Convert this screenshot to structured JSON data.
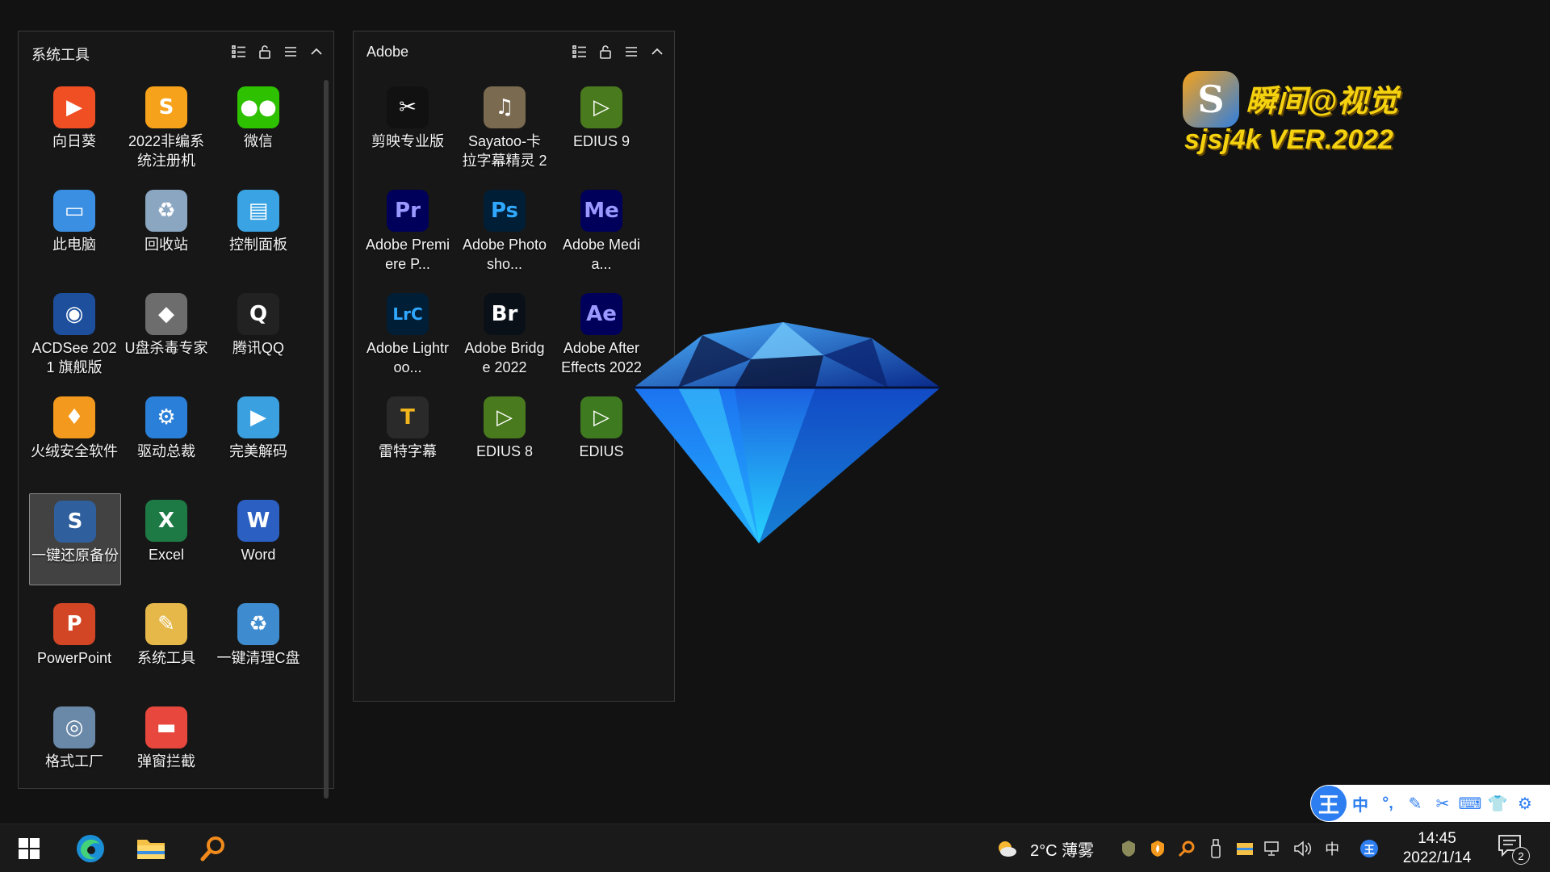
{
  "fences": {
    "system": {
      "title": "系统工具",
      "icons": [
        {
          "label": "向日葵",
          "glyph": "▶",
          "color": "#f04e23",
          "icon": "sunlogin-icon"
        },
        {
          "label": "2022非编系统注册机",
          "glyph": "S",
          "color": "#f7a21b",
          "icon": "registration-tool-icon"
        },
        {
          "label": "微信",
          "glyph": "●●",
          "color": "#2dc100",
          "icon": "wechat-icon"
        },
        {
          "label": "此电脑",
          "glyph": "▭",
          "color": "#3b8fe3",
          "icon": "this-pc-icon"
        },
        {
          "label": "回收站",
          "glyph": "♻",
          "color": "#8aa6c1",
          "icon": "recycle-bin-icon"
        },
        {
          "label": "控制面板",
          "glyph": "▤",
          "color": "#3aa3e3",
          "icon": "control-panel-icon"
        },
        {
          "label": "ACDSee 2021 旗舰版",
          "glyph": "◉",
          "color": "#1d4f9c",
          "icon": "acdsee-icon"
        },
        {
          "label": "U盘杀毒专家",
          "glyph": "◆",
          "color": "#6d6d6d",
          "icon": "usb-antivirus-icon"
        },
        {
          "label": "腾讯QQ",
          "glyph": "Q",
          "color": "#222222",
          "icon": "qq-icon"
        },
        {
          "label": "火绒安全软件",
          "glyph": "♦",
          "color": "#f39a1e",
          "icon": "huorong-icon"
        },
        {
          "label": "驱动总裁",
          "glyph": "⚙",
          "color": "#2a7fd8",
          "icon": "driver-tool-icon"
        },
        {
          "label": "完美解码",
          "glyph": "▶",
          "color": "#3aa0e0",
          "icon": "potplayer-icon"
        },
        {
          "label": "一键还原备份",
          "glyph": "S",
          "color": "#2f5f9c",
          "icon": "restore-backup-icon"
        },
        {
          "label": "Excel",
          "glyph": "X",
          "color": "#1d7a45",
          "icon": "excel-icon"
        },
        {
          "label": "Word",
          "glyph": "W",
          "color": "#2b5fc2",
          "icon": "word-icon"
        },
        {
          "label": "PowerPoint",
          "glyph": "P",
          "color": "#d24625",
          "icon": "powerpoint-icon"
        },
        {
          "label": "系统工具",
          "glyph": "✎",
          "color": "#e6b84a",
          "icon": "system-tools-icon"
        },
        {
          "label": "一键清理C盘",
          "glyph": "♻",
          "color": "#3e8ccf",
          "icon": "clean-drive-icon"
        },
        {
          "label": "格式工厂",
          "glyph": "◎",
          "color": "#6a88a8",
          "icon": "format-factory-icon"
        },
        {
          "label": "弹窗拦截",
          "glyph": "▬",
          "color": "#e8473d",
          "icon": "popup-blocker-icon"
        }
      ]
    },
    "adobe": {
      "title": "Adobe",
      "icons": [
        {
          "label": "剪映专业版",
          "glyph": "✂",
          "color": "#111111",
          "icon": "capcut-icon"
        },
        {
          "label": "Sayatoo-卡拉字幕精灵 2",
          "glyph": "♫",
          "color": "#7a6a50",
          "icon": "sayatoo-icon"
        },
        {
          "label": "EDIUS 9",
          "glyph": "▷",
          "color": "#4a7a1e",
          "icon": "edius9-icon"
        },
        {
          "label": "Adobe Premiere P...",
          "glyph": "Pr",
          "color": "#00005b",
          "fg": "#9999ff",
          "icon": "premiere-icon"
        },
        {
          "label": "Adobe Photosho...",
          "glyph": "Ps",
          "color": "#001e36",
          "fg": "#31a8ff",
          "icon": "photoshop-icon"
        },
        {
          "label": "Adobe Media...",
          "glyph": "Me",
          "color": "#00005b",
          "fg": "#9999ff",
          "icon": "media-encoder-icon"
        },
        {
          "label": "Adobe Lightroo...",
          "glyph": "LrC",
          "color": "#001e36",
          "fg": "#31a8ff",
          "icon": "lightroom-icon"
        },
        {
          "label": "Adobe Bridge 2022",
          "glyph": "Br",
          "color": "#0a1018",
          "fg": "#ffffff",
          "icon": "bridge-icon"
        },
        {
          "label": "Adobe After Effects 2022",
          "glyph": "Ae",
          "color": "#00005b",
          "fg": "#9999ff",
          "icon": "after-effects-icon"
        },
        {
          "label": "雷特字幕",
          "glyph": "T",
          "color": "#2a2a2a",
          "fg": "#f2b61c",
          "icon": "leite-subtitle-icon"
        },
        {
          "label": "EDIUS 8",
          "glyph": "▷",
          "color": "#4a7a1e",
          "icon": "edius8-icon"
        },
        {
          "label": "EDIUS",
          "glyph": "▷",
          "color": "#3e7a20",
          "icon": "edius-icon"
        }
      ]
    }
  },
  "logo": {
    "badge": "S",
    "cn_text": "瞬间@视觉",
    "en_text": "sjsj4k VER.2022"
  },
  "ime": {
    "logo": "王",
    "buttons": [
      "中",
      "°,",
      "✎",
      "✂",
      "⌨",
      "👕",
      "⚙"
    ]
  },
  "taskbar": {
    "weather": "2°C 薄雾",
    "ime_mode": "中",
    "ime_tray": "王",
    "time": "14:45",
    "date": "2022/1/14",
    "notifications": "2"
  }
}
